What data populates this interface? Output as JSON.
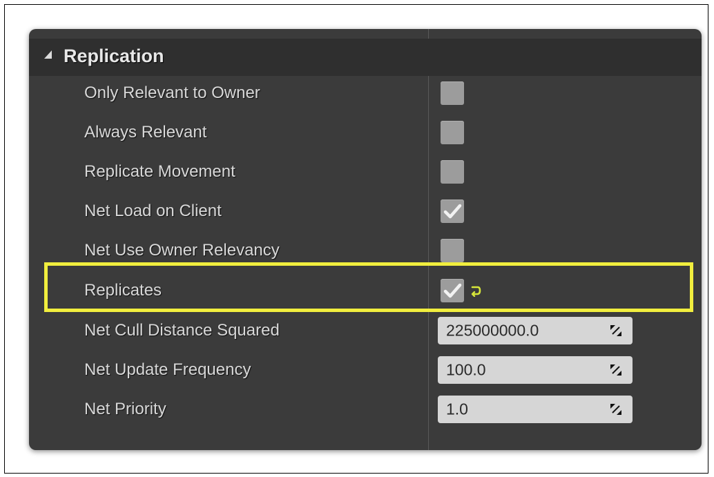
{
  "section": {
    "title": "Replication"
  },
  "properties": [
    {
      "label": "Only Relevant to Owner",
      "type": "checkbox",
      "checked": false
    },
    {
      "label": "Always Relevant",
      "type": "checkbox",
      "checked": false
    },
    {
      "label": "Replicate Movement",
      "type": "checkbox",
      "checked": false
    },
    {
      "label": "Net Load on Client",
      "type": "checkbox",
      "checked": true
    },
    {
      "label": "Net Use Owner Relevancy",
      "type": "checkbox",
      "checked": false
    },
    {
      "label": "Replicates",
      "type": "checkbox",
      "checked": true,
      "highlighted": true,
      "reset_to_default": true
    },
    {
      "label": "Net Cull Distance Squared",
      "type": "number",
      "value": "225000000.0"
    },
    {
      "label": "Net Update Frequency",
      "type": "number",
      "value": "100.0"
    },
    {
      "label": "Net Priority",
      "type": "number",
      "value": "1.0"
    }
  ],
  "colors": {
    "highlight": "#f1ee3e",
    "panel": "#3b3b3b",
    "reset_icon": "#d6e63a"
  },
  "icons": {
    "collapse": "triangle-collapse-icon",
    "check": "checkmark-icon",
    "reset": "reset-to-default-arrow-icon",
    "spin": "drag-spin-arrows-icon"
  }
}
